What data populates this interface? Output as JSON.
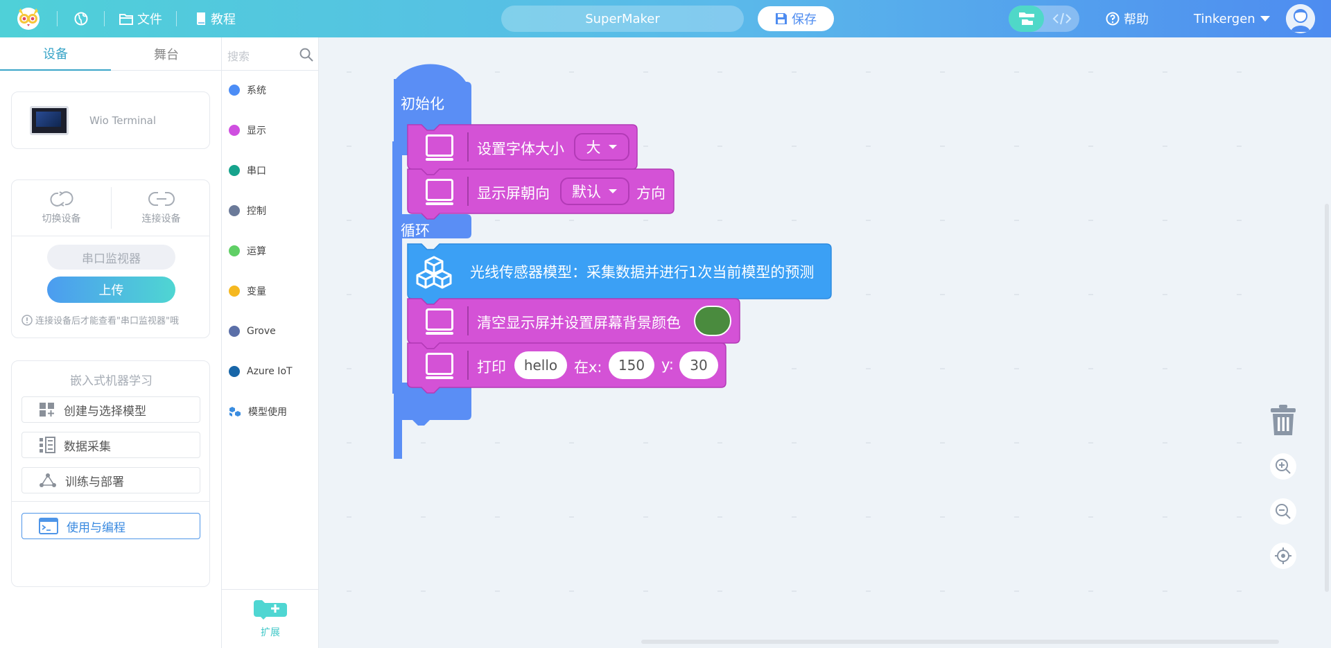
{
  "topbar": {
    "file_label": "文件",
    "tutorial_label": "教程",
    "project_name": "SuperMaker",
    "save_label": "保存",
    "help_label": "帮助",
    "user_name": "Tinkergen"
  },
  "left_tabs": [
    "设备",
    "舞台"
  ],
  "device": {
    "name": "Wio Terminal"
  },
  "device_actions": {
    "switch_label": "切换设备",
    "connect_label": "连接设备"
  },
  "serial_monitor_label": "串口监视器",
  "upload_label": "上传",
  "hint": "连接设备后才能查看\"串口监视器\"哦",
  "ml": {
    "title": "嵌入式机器学习",
    "items": [
      "创建与选择模型",
      "数据采集",
      "训练与部署",
      "使用与编程"
    ],
    "active_index": 3
  },
  "search": {
    "placeholder": "搜索"
  },
  "categories": [
    {
      "label": "系统",
      "color": "#4c8df6"
    },
    {
      "label": "显示",
      "color": "#cf4fe0"
    },
    {
      "label": "串口",
      "color": "#16a38c"
    },
    {
      "label": "控制",
      "color": "#6b7a99"
    },
    {
      "label": "运算",
      "color": "#5fcf65"
    },
    {
      "label": "变量",
      "color": "#f5b820"
    },
    {
      "label": "Grove",
      "color": "#5b6fa8"
    },
    {
      "label": "Azure IoT",
      "color": "#1866a8"
    },
    {
      "label": "模型使用",
      "color": "#3b8de0"
    }
  ],
  "extension_label": "扩展",
  "blocks": {
    "init_label": "初始化",
    "loop_label": "循环",
    "set_font": {
      "label": "设置字体大小",
      "value": "大"
    },
    "screen_orient": {
      "label": "显示屏朝向",
      "value": "默认",
      "suffix": "方向"
    },
    "model_block": {
      "label": "光线传感器模型：采集数据并进行1次当前模型的预测"
    },
    "clear_screen": {
      "label": "清空显示屏并设置屏幕背景颜色",
      "color": "#4a8b3e"
    },
    "print": {
      "label": "打印",
      "text": "hello",
      "x_label": "在x:",
      "x": "150",
      "y_label": "y:",
      "y": "30"
    }
  },
  "colors": {
    "event_block": "#5a8ef5",
    "display_block": "#d452d6",
    "model_block": "#3ba0f5",
    "accent": "#3aa5c8"
  }
}
